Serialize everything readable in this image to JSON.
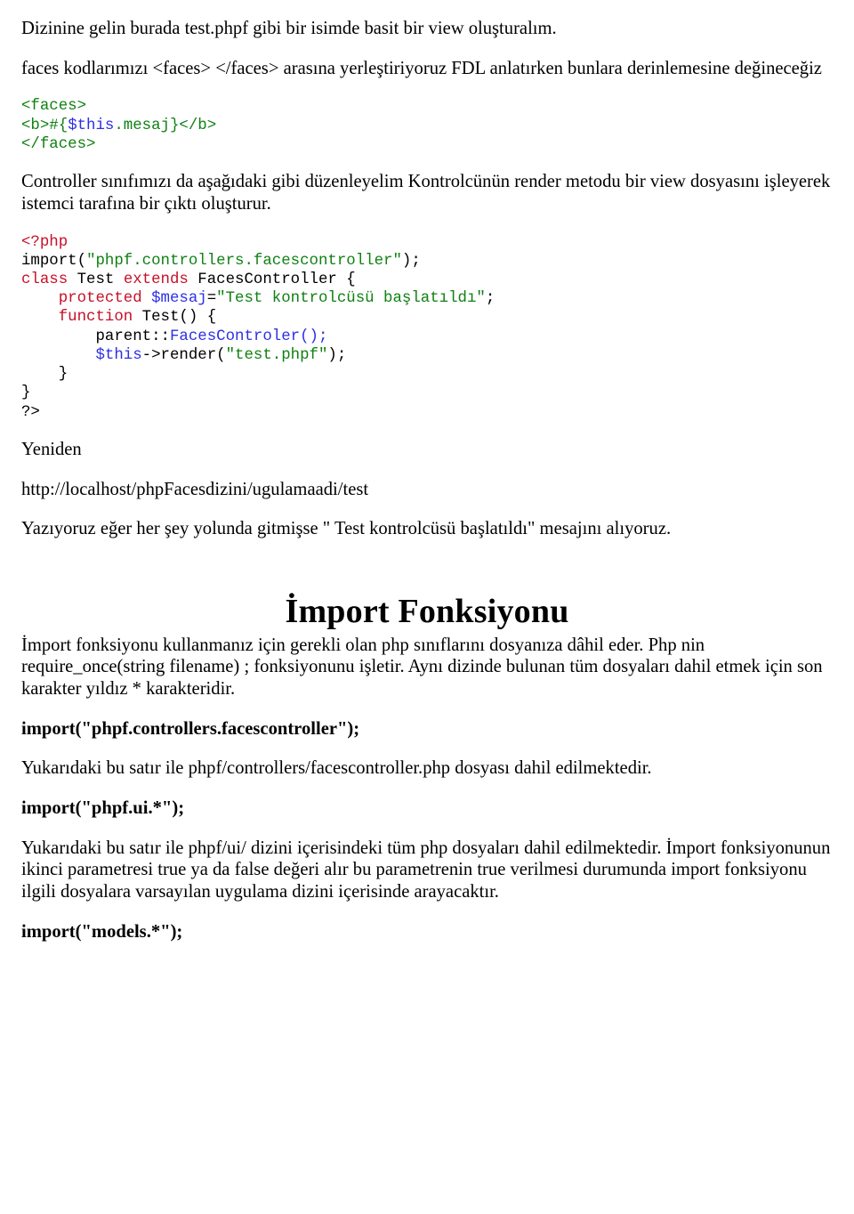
{
  "p1": "Dizinine gelin burada test.phpf gibi bir isimde basit bir view oluşturalım.",
  "p2": "faces kodlarımızı <faces> </faces> arasına yerleştiriyoruz FDL anlatırken bunlara derinlemesine değineceğiz",
  "code1_l1": "<faces>",
  "code1_l2a": "<b>#{",
  "code1_l2b": "$this",
  "code1_l2c": ".mesaj}</b>",
  "code1_l3": "</faces>",
  "p3": "Controller sınıfımızı da aşağıdaki gibi düzenleyelim Kontrolcünün render metodu bir view dosyasını işleyerek istemci tarafına bir çıktı oluşturur.",
  "c2_l1": "<?php",
  "c2_l2a": "import(",
  "c2_l2b": "\"phpf.controllers.facescontroller\"",
  "c2_l2c": ");",
  "c2_l3a": "class",
  "c2_l3b": " Test ",
  "c2_l3c": "extends",
  "c2_l3d": " FacesController {",
  "c2_l4a": "    protected",
  "c2_l4b": " $mesaj",
  "c2_l4c": "=",
  "c2_l4d": "\"Test kontrolcüsü başlatıldı\"",
  "c2_l4e": ";",
  "c2_l5a": "    function",
  "c2_l5b": " Test() {",
  "c2_l6a": "        parent::",
  "c2_l6b": "FacesControler();",
  "c2_l7a": "        $this",
  "c2_l7b": "->render(",
  "c2_l7c": "\"test.phpf\"",
  "c2_l7d": ");",
  "c2_l8": "    }",
  "c2_l9": "}",
  "c2_l10": "?>",
  "p4": "Yeniden",
  "p5": "http://localhost/phpFacesdizini/ugulamaadi/test",
  "p6": "Yazıyoruz eğer her şey yolunda gitmişse \" Test kontrolcüsü başlatıldı\" mesajını alıyoruz.",
  "h2_1": "İmport Fonksiyonu",
  "p7": "İmport fonksiyonu kullanmanız için gerekli olan php sınıflarını dosyanıza dâhil eder. Php nin require_once(string filename) ; fonksiyonunu işletir. Aynı dizinde bulunan tüm dosyaları dahil etmek için son karakter yıldız * karakteridir.",
  "bc1": "import(\"phpf.controllers.facescontroller\");",
  "p8": "Yukarıdaki bu satır ile  phpf/controllers/facescontroller.php dosyası dahil edilmektedir.",
  "bc2": "import(\"phpf.ui.*\");",
  "p9": "Yukarıdaki bu satır ile  phpf/ui/ dizini içerisindeki tüm php dosyaları  dahil edilmektedir. İmport fonksiyonunun ikinci parametresi true ya da false değeri alır bu parametrenin true verilmesi durumunda import fonksiyonu ilgili dosyalara varsayılan uygulama dizini içerisinde arayacaktır.",
  "bc3": "import(\"models.*\");"
}
